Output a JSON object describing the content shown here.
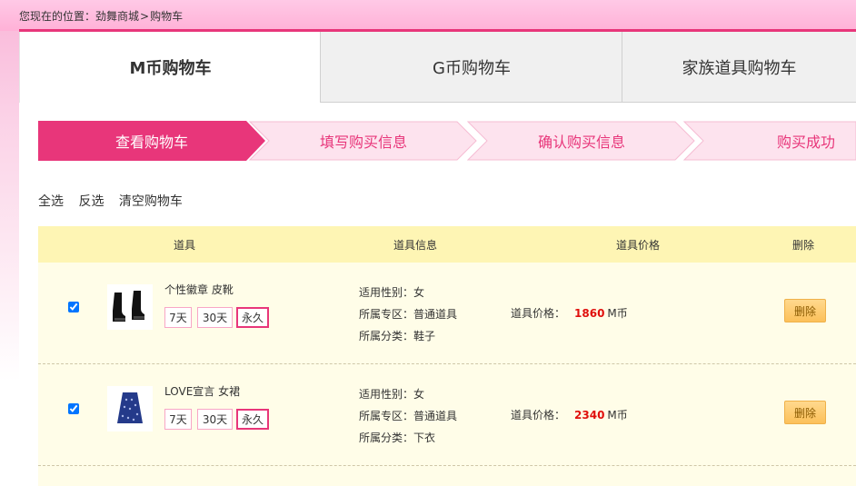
{
  "breadcrumb": {
    "prefix": "您现在的位置：",
    "home": "劲舞商城",
    "sep": ">",
    "current": "购物车"
  },
  "tabs": [
    {
      "label": "M币购物车"
    },
    {
      "label": "G币购物车"
    },
    {
      "label": "家族道具购物车"
    }
  ],
  "steps": [
    {
      "label": "查看购物车"
    },
    {
      "label": "填写购买信息"
    },
    {
      "label": "确认购买信息"
    },
    {
      "label": "购买成功"
    }
  ],
  "actions": {
    "select_all": "全选",
    "invert": "反选",
    "clear": "清空购物车"
  },
  "columns": {
    "item": "道具",
    "info": "道具信息",
    "price": "道具价格",
    "delete": "删除"
  },
  "items": [
    {
      "name": "个性徽章 皮靴",
      "durations": [
        "7天",
        "30天",
        "永久"
      ],
      "gender": "适用性别：女",
      "zone": "所属专区：普通道具",
      "category": "所属分类：鞋子",
      "price_label": "道具价格：",
      "price": "1860",
      "unit": "M币",
      "delete_label": "删除",
      "icon": "boots-icon"
    },
    {
      "name": "LOVE宣言 女裙",
      "durations": [
        "7天",
        "30天",
        "永久"
      ],
      "gender": "适用性别：女",
      "zone": "所属专区：普通道具",
      "category": "所属分类：下衣",
      "price_label": "道具价格：",
      "price": "2340",
      "unit": "M币",
      "delete_label": "删除",
      "icon": "skirt-icon"
    }
  ],
  "colors": {
    "accent": "#e8367a",
    "price": "#e0100d",
    "header_bg": "#fef5b4"
  }
}
